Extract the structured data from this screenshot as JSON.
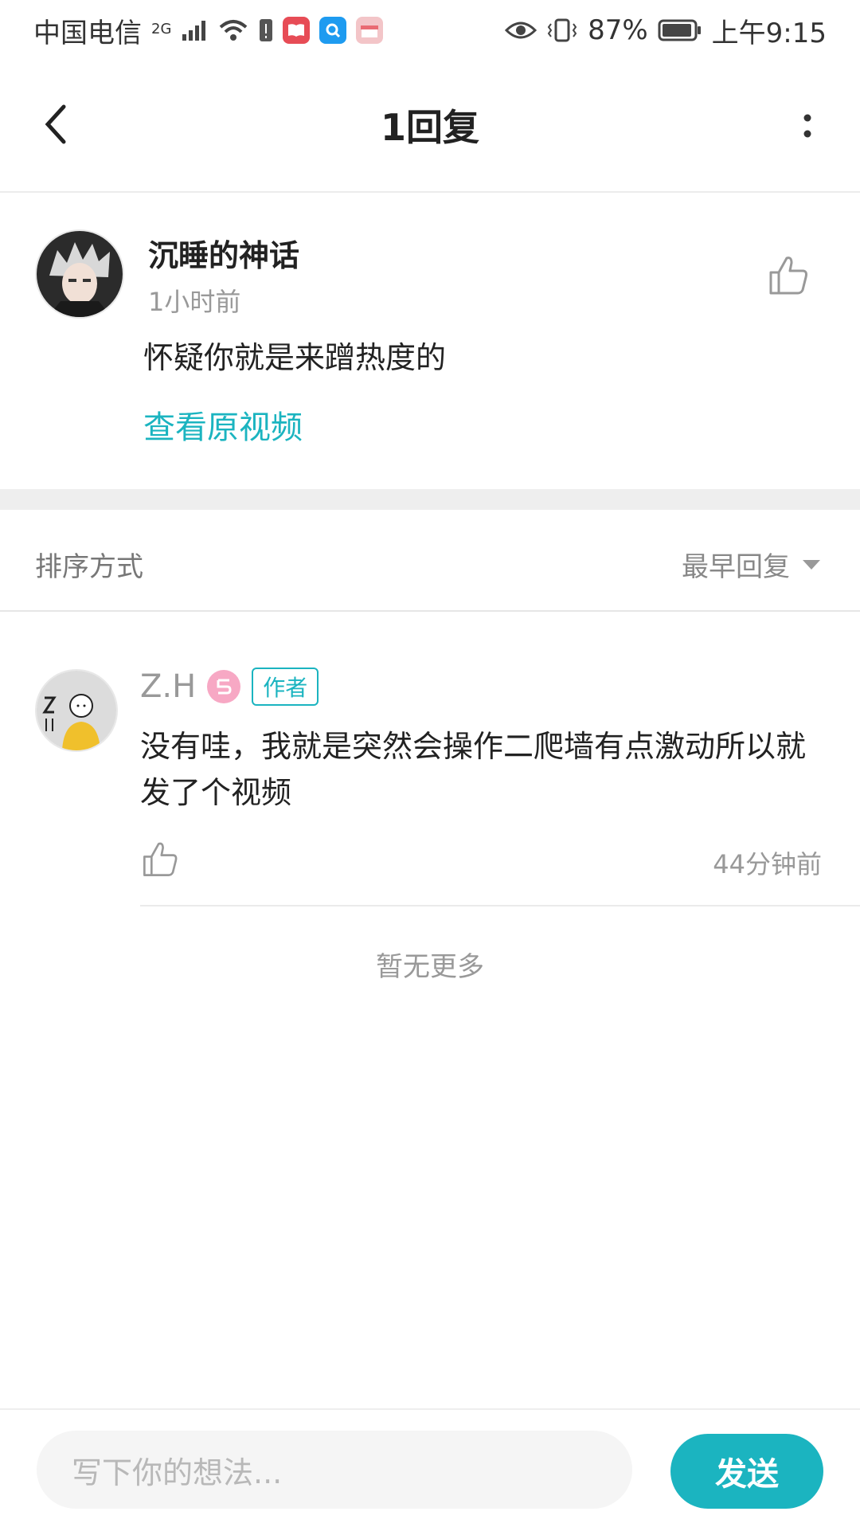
{
  "status_bar": {
    "carrier": "中国电信",
    "network_label": "2G",
    "battery_percent_text": "87%",
    "time": "上午9:15",
    "icons": [
      "signal-icon",
      "wifi-icon",
      "alert-icon",
      "book-app-icon",
      "search-app-icon",
      "gift-app-icon",
      "eye-icon",
      "vibrate-icon",
      "battery-icon"
    ]
  },
  "header": {
    "title": "1回复"
  },
  "post": {
    "username": "沉睡的神话",
    "time": "1小时前",
    "text": "怀疑你就是来蹭热度的",
    "link": "查看原视频"
  },
  "sort": {
    "label": "排序方式",
    "value": "最早回复"
  },
  "replies": [
    {
      "username": "Z.H",
      "tag": "作者",
      "text": "没有哇，我就是突然会操作二爬墙有点激动所以就发了个视频",
      "time": "44分钟前"
    }
  ],
  "footer_text": "暂无更多",
  "composer": {
    "placeholder": "写下你的想法...",
    "send_label": "发送"
  },
  "colors": {
    "accent": "#1bb4c0",
    "author_tag": "#1bb4c0",
    "level_badge": "#f7a8c4"
  }
}
